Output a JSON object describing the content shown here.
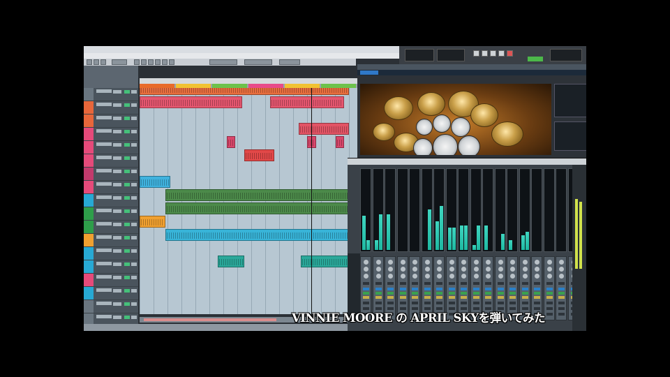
{
  "video": {
    "caption": "VINNIE MOORE の APRIL SKYを弾いてみた"
  },
  "daw": {
    "title": "",
    "menu": [],
    "marker_colors": [
      "#e86b2a",
      "#f1c232",
      "#6dc24b",
      "#e84b8a",
      "#f1c232",
      "#6dc24b"
    ],
    "tracks": [
      {
        "color": "#6a7680"
      },
      {
        "color": "#e8663a"
      },
      {
        "color": "#e8663a"
      },
      {
        "color": "#e64a7a"
      },
      {
        "color": "#e64a7a"
      },
      {
        "color": "#e64a7a"
      },
      {
        "color": "#c23a6c"
      },
      {
        "color": "#e64a7a"
      },
      {
        "color": "#27a9d4"
      },
      {
        "color": "#2e9e4a"
      },
      {
        "color": "#2e9e4a"
      },
      {
        "color": "#f0a030"
      },
      {
        "color": "#27a9d4"
      },
      {
        "color": "#27a9d4"
      },
      {
        "color": "#e64a7a"
      },
      {
        "color": "#27a9d4"
      },
      {
        "color": "#6a7680"
      },
      {
        "color": "#6a7680"
      }
    ],
    "parts": [
      {
        "track": 1,
        "start": 0.0,
        "end": 0.96,
        "color": "#e86e3e"
      },
      {
        "track": 2,
        "start": 0.0,
        "end": 0.47,
        "color": "#e5566f"
      },
      {
        "track": 2,
        "start": 0.6,
        "end": 0.94,
        "color": "#e5566f"
      },
      {
        "track": 4,
        "start": 0.73,
        "end": 0.96,
        "color": "#e25465"
      },
      {
        "track": 5,
        "start": 0.4,
        "end": 0.44,
        "color": "#d8466a"
      },
      {
        "track": 5,
        "start": 0.77,
        "end": 0.81,
        "color": "#d8466a"
      },
      {
        "track": 5,
        "start": 0.9,
        "end": 0.94,
        "color": "#d8466a"
      },
      {
        "track": 6,
        "start": 0.48,
        "end": 0.62,
        "color": "#e24848"
      },
      {
        "track": 8,
        "start": 0.0,
        "end": 0.14,
        "color": "#3fb2de"
      },
      {
        "track": 9,
        "start": 0.12,
        "end": 0.96,
        "color": "#4c8a4a"
      },
      {
        "track": 10,
        "start": 0.12,
        "end": 0.96,
        "color": "#4c8a4a"
      },
      {
        "track": 11,
        "start": 0.0,
        "end": 0.12,
        "color": "#f0a030"
      },
      {
        "track": 12,
        "start": 0.12,
        "end": 0.96,
        "color": "#38b4d8"
      },
      {
        "track": 14,
        "start": 0.36,
        "end": 0.48,
        "color": "#2aa89a"
      },
      {
        "track": 14,
        "start": 0.74,
        "end": 0.96,
        "color": "#2aa89a"
      }
    ],
    "playhead_position": 0.79
  },
  "mixer": {
    "meter_levels": [
      0.42,
      0.12,
      0.12,
      0.44,
      0.44,
      0.0,
      0.0,
      0.0,
      0.0,
      0.0,
      0.0,
      0.5,
      0.35,
      0.54,
      0.28,
      0.28,
      0.3,
      0.3,
      0.06,
      0.3,
      0.3,
      0.0,
      0.0,
      0.2,
      0.12,
      0.0,
      0.18,
      0.22
    ],
    "channel_count": 18
  }
}
